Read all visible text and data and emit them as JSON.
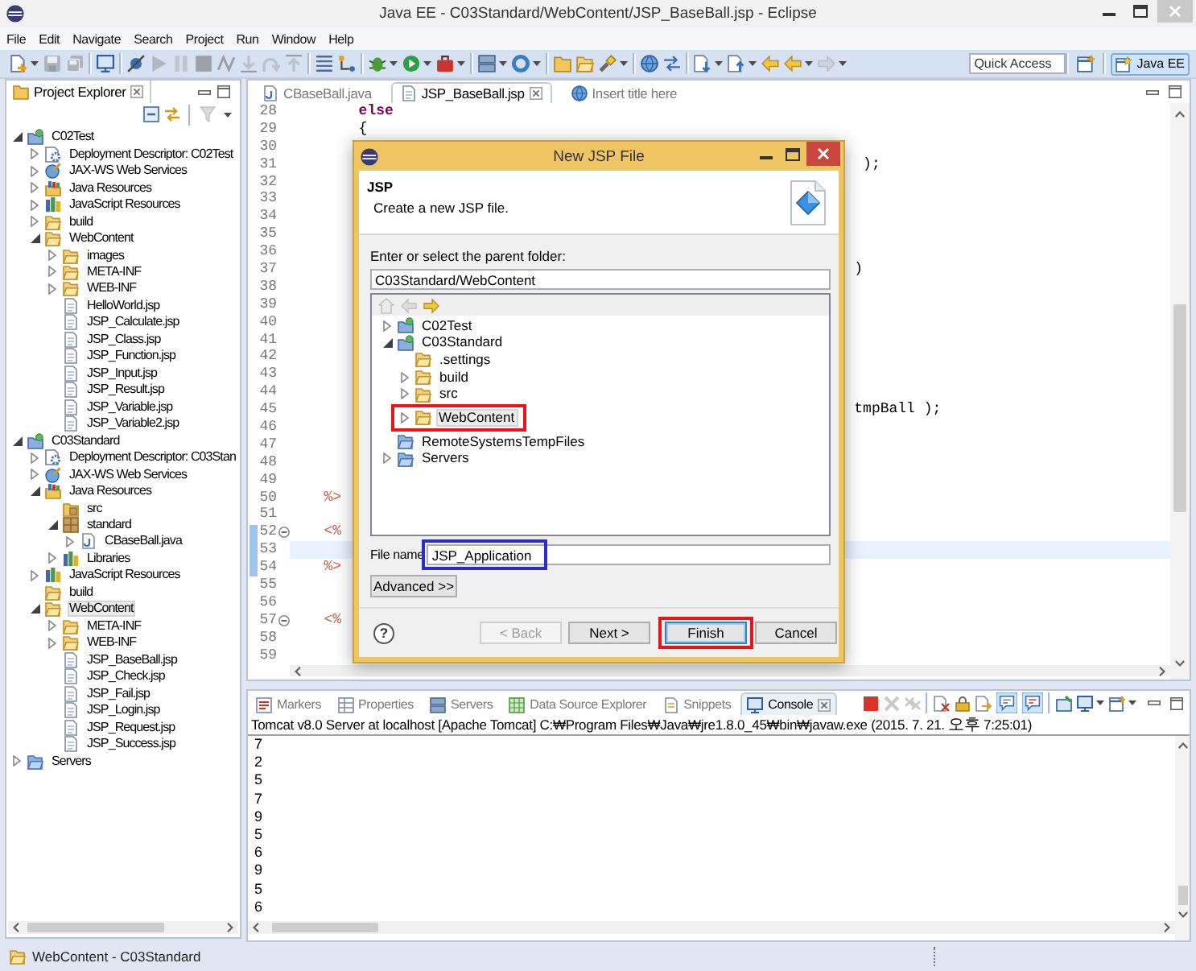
{
  "window": {
    "title": "Java EE - C03Standard/WebContent/JSP_BaseBall.jsp - Eclipse"
  },
  "menu": [
    "File",
    "Edit",
    "Navigate",
    "Search",
    "Project",
    "Run",
    "Window",
    "Help"
  ],
  "toolbar": {
    "groups": [
      [
        {
          "disabled": false,
          "dropdown": true
        },
        {
          "disabled": true,
          "dropdown": false
        },
        {
          "disabled": true,
          "dropdown": false
        }
      ],
      [
        {
          "disabled": false,
          "dropdown": false
        }
      ],
      [
        {
          "disabled": false,
          "dropdown": false
        },
        {
          "disabled": true,
          "dropdown": false
        },
        {
          "disabled": true,
          "dropdown": false
        },
        {
          "disabled": true,
          "dropdown": false
        },
        {
          "disabled": true,
          "dropdown": false
        },
        {
          "disabled": true,
          "dropdown": false
        },
        {
          "disabled": true,
          "dropdown": false
        },
        {
          "disabled": true,
          "dropdown": false
        }
      ],
      [
        {
          "disabled": false,
          "dropdown": false
        },
        {
          "disabled": false,
          "dropdown": false
        }
      ],
      [
        {
          "disabled": false,
          "dropdown": true
        },
        {
          "disabled": false,
          "dropdown": true
        },
        {
          "disabled": false,
          "dropdown": true
        }
      ],
      [
        {
          "disabled": false,
          "dropdown": true
        },
        {
          "disabled": false,
          "dropdown": true
        }
      ],
      [
        {
          "disabled": false,
          "dropdown": false
        },
        {
          "disabled": false,
          "dropdown": false
        },
        {
          "disabled": false,
          "dropdown": true
        }
      ],
      [
        {
          "disabled": false,
          "dropdown": false
        },
        {
          "disabled": false,
          "dropdown": false
        }
      ],
      [
        {
          "disabled": false,
          "dropdown": true
        },
        {
          "disabled": false,
          "dropdown": true
        },
        {
          "disabled": false,
          "dropdown": false
        },
        {
          "disabled": false,
          "dropdown": true
        },
        {
          "disabled": true,
          "dropdown": true
        }
      ]
    ],
    "quick_access": {
      "placeholder": "Quick Access"
    },
    "perspectives": [
      {
        "label": "Java EE",
        "selected": true
      }
    ]
  },
  "explorer": {
    "tab": {
      "label": "Project Explorer",
      "selected": true
    },
    "toolbar": [
      {
        "disabled": false
      },
      {
        "disabled": false
      },
      {
        "disabled": true
      }
    ],
    "tree": [
      {
        "label": "C02Test",
        "kind": "project",
        "expanded": true,
        "selected": false,
        "children": [
          {
            "label": "Deployment Descriptor: C02Test",
            "kind": "descriptor",
            "expanded": false,
            "selected": false
          },
          {
            "label": "JAX-WS Web Services",
            "kind": "webservices",
            "expanded": false,
            "selected": false
          },
          {
            "label": "Java Resources",
            "kind": "javaresources",
            "expanded": false,
            "selected": false
          },
          {
            "label": "JavaScript Resources",
            "kind": "jsresources",
            "expanded": false,
            "selected": false
          },
          {
            "label": "build",
            "kind": "folder",
            "expanded": false,
            "selected": false
          },
          {
            "label": "WebContent",
            "kind": "folder",
            "expanded": true,
            "selected": false,
            "children": [
              {
                "label": "images",
                "kind": "folder",
                "expanded": false,
                "selected": false
              },
              {
                "label": "META-INF",
                "kind": "folder",
                "expanded": false,
                "selected": false
              },
              {
                "label": "WEB-INF",
                "kind": "folder",
                "expanded": false,
                "selected": false
              },
              {
                "label": "HelloWorld.jsp",
                "kind": "jsp",
                "selected": false
              },
              {
                "label": "JSP_Calculate.jsp",
                "kind": "jsp",
                "selected": false
              },
              {
                "label": "JSP_Class.jsp",
                "kind": "jsp",
                "selected": false
              },
              {
                "label": "JSP_Function.jsp",
                "kind": "jsp",
                "selected": false
              },
              {
                "label": "JSP_Input.jsp",
                "kind": "jsp",
                "selected": false
              },
              {
                "label": "JSP_Result.jsp",
                "kind": "jsp",
                "selected": false
              },
              {
                "label": "JSP_Variable.jsp",
                "kind": "jsp",
                "selected": false
              },
              {
                "label": "JSP_Variable2.jsp",
                "kind": "jsp",
                "selected": false
              }
            ]
          }
        ]
      },
      {
        "label": "C03Standard",
        "kind": "project",
        "expanded": true,
        "selected": false,
        "children": [
          {
            "label": "Deployment Descriptor: C03Stan",
            "kind": "descriptor",
            "expanded": false,
            "selected": false
          },
          {
            "label": "JAX-WS Web Services",
            "kind": "webservices",
            "expanded": false,
            "selected": false
          },
          {
            "label": "Java Resources",
            "kind": "javaresources",
            "expanded": true,
            "selected": false,
            "children": [
              {
                "label": "src",
                "kind": "sourcefolder",
                "selected": false
              },
              {
                "label": "standard",
                "kind": "package",
                "expanded": true,
                "selected": false,
                "children": [
                  {
                    "label": "CBaseBall.java",
                    "kind": "java",
                    "expanded": false,
                    "selected": false
                  }
                ]
              },
              {
                "label": "Libraries",
                "kind": "library",
                "expanded": false,
                "selected": false
              }
            ]
          },
          {
            "label": "JavaScript Resources",
            "kind": "jsresources",
            "expanded": false,
            "selected": false
          },
          {
            "label": "build",
            "kind": "folder",
            "selected": false
          },
          {
            "label": "WebContent",
            "kind": "folder",
            "expanded": true,
            "selected": true,
            "children": [
              {
                "label": "META-INF",
                "kind": "folder",
                "expanded": false,
                "selected": false
              },
              {
                "label": "WEB-INF",
                "kind": "folder",
                "expanded": false,
                "selected": false
              },
              {
                "label": "JSP_BaseBall.jsp",
                "kind": "jsp",
                "selected": false
              },
              {
                "label": "JSP_Check.jsp",
                "kind": "jsp",
                "selected": false
              },
              {
                "label": "JSP_Fail.jsp",
                "kind": "jsp",
                "selected": false
              },
              {
                "label": "JSP_Login.jsp",
                "kind": "jsp",
                "selected": false
              },
              {
                "label": "JSP_Request.jsp",
                "kind": "jsp",
                "selected": false
              },
              {
                "label": "JSP_Success.jsp",
                "kind": "jsp",
                "selected": false
              }
            ]
          }
        ]
      },
      {
        "label": "Servers",
        "kind": "serverfolder",
        "expanded": false,
        "selected": false
      }
    ]
  },
  "editor": {
    "tabs": [
      {
        "label": "CBaseBall.java",
        "kind": "java",
        "selected": false
      },
      {
        "label": "JSP_BaseBall.jsp",
        "kind": "jsp",
        "selected": true
      },
      {
        "label": "Insert title here",
        "kind": "web",
        "selected": false
      }
    ],
    "lines": [
      {
        "number": "28",
        "code": "       else",
        "kind": "keyword",
        "current": false,
        "range": false
      },
      {
        "number": "29",
        "code": "       {",
        "kind": "plain",
        "current": false,
        "range": false
      },
      {
        "number": "30",
        "current": false,
        "range": false
      },
      {
        "number": "31",
        "code": "                                                                 );",
        "kind": "plain",
        "current": false,
        "range": false
      },
      {
        "number": "32",
        "current": false,
        "range": false
      },
      {
        "number": "33",
        "current": false,
        "range": false
      },
      {
        "number": "34",
        "current": false,
        "range": false
      },
      {
        "number": "35",
        "current": false,
        "range": false
      },
      {
        "number": "36",
        "current": false,
        "range": false
      },
      {
        "number": "37",
        "code": "                                                                )",
        "kind": "plain",
        "current": false,
        "range": false
      },
      {
        "number": "38",
        "current": false,
        "range": false
      },
      {
        "number": "39",
        "current": false,
        "range": false
      },
      {
        "number": "40",
        "current": false,
        "range": false
      },
      {
        "number": "41",
        "current": false,
        "range": false
      },
      {
        "number": "42",
        "current": false,
        "range": false
      },
      {
        "number": "43",
        "current": false,
        "range": false
      },
      {
        "number": "44",
        "current": false,
        "range": false
      },
      {
        "number": "45",
        "code": "                                                                tmpBall );",
        "kind": "plain",
        "current": false,
        "range": false
      },
      {
        "number": "46",
        "current": false,
        "range": false
      },
      {
        "number": "47",
        "current": false,
        "range": false
      },
      {
        "number": "48",
        "current": false,
        "range": false
      },
      {
        "number": "49",
        "current": false,
        "range": false
      },
      {
        "number": "50",
        "code": "   %>",
        "kind": "delimiter",
        "current": false,
        "range": false
      },
      {
        "number": "51",
        "current": false,
        "range": false
      },
      {
        "number": "52",
        "code": "   <%",
        "kind": "delimiter",
        "expanded": true,
        "current": false,
        "range": true
      },
      {
        "number": "53",
        "current": true,
        "range": true
      },
      {
        "number": "54",
        "code": "   %>",
        "kind": "delimiter",
        "current": false,
        "range": true
      },
      {
        "number": "55",
        "current": false,
        "range": false
      },
      {
        "number": "56",
        "current": false,
        "range": false
      },
      {
        "number": "57",
        "code": "   <%",
        "kind": "delimiter",
        "expanded": true,
        "current": false,
        "range": false
      },
      {
        "number": "58",
        "current": false,
        "range": false
      },
      {
        "number": "59",
        "current": false,
        "range": false
      }
    ]
  },
  "dialog": {
    "title": "New JSP File",
    "heading": "JSP",
    "description": "Create a new JSP file.",
    "folder_label": "Enter or select the parent folder:",
    "folder_value": "C03Standard/WebContent",
    "tree_toolbar": [
      {
        "disabled": true
      },
      {
        "disabled": true
      },
      {
        "disabled": false
      }
    ],
    "tree": [
      {
        "label": "C02Test",
        "kind": "project",
        "expanded": false,
        "selected": false
      },
      {
        "label": "C03Standard",
        "kind": "project",
        "expanded": true,
        "selected": false,
        "children": [
          {
            "label": ".settings",
            "kind": "folder",
            "selected": false
          },
          {
            "label": "build",
            "kind": "folder",
            "expanded": false,
            "selected": false
          },
          {
            "label": "src",
            "kind": "folder",
            "expanded": false,
            "selected": false
          },
          {
            "label": "WebContent",
            "kind": "folder",
            "expanded": false,
            "selected": true,
            "highlight": {
              "color": "#e8151b"
            }
          }
        ]
      },
      {
        "label": "RemoteSystemsTempFiles",
        "kind": "serverfolder",
        "selected": false
      },
      {
        "label": "Servers",
        "kind": "serverfolder",
        "expanded": false,
        "selected": false
      }
    ],
    "file_name": {
      "label": "File name",
      "value": "JSP_Application",
      "highlight": {
        "color": "#2b2bd0"
      }
    },
    "advanced": "Advanced >>",
    "help": "?",
    "buttons": [
      {
        "label": "< Back",
        "disabled": true,
        "default": false
      },
      {
        "label": "Next >",
        "disabled": false,
        "default": false
      },
      {
        "label": "Finish",
        "disabled": false,
        "default": true,
        "highlight": {
          "color": "#e8151b"
        }
      },
      {
        "label": "Cancel",
        "disabled": false,
        "default": false
      }
    ]
  },
  "console": {
    "tabs": [
      {
        "label": "Markers",
        "selected": false
      },
      {
        "label": "Properties",
        "selected": false
      },
      {
        "label": "Servers",
        "selected": false
      },
      {
        "label": "Data Source Explorer",
        "selected": false
      },
      {
        "label": "Snippets",
        "selected": false
      },
      {
        "label": "Console",
        "selected": true
      }
    ],
    "toolbar": {
      "groups": [
        [
          {
            "disabled": false,
            "on": false,
            "dropdown": false
          },
          {
            "disabled": true,
            "on": false,
            "dropdown": false
          },
          {
            "disabled": true,
            "on": false,
            "dropdown": false
          }
        ],
        [
          {
            "disabled": false,
            "on": false,
            "dropdown": false
          },
          {
            "disabled": false,
            "on": false,
            "dropdown": false
          },
          {
            "disabled": false,
            "on": false,
            "dropdown": false
          },
          {
            "disabled": false,
            "on": true,
            "dropdown": false
          },
          {
            "disabled": false,
            "on": true,
            "dropdown": false
          }
        ],
        [
          {
            "disabled": false,
            "on": false,
            "dropdown": false
          },
          {
            "disabled": false,
            "on": false,
            "dropdown": true
          },
          {
            "disabled": false,
            "on": false,
            "dropdown": true
          }
        ]
      ]
    },
    "process": "Tomcat v8.0 Server at localhost [Apache Tomcat] C:₩Program Files₩Java₩jre1.8.0_45₩bin₩javaw.exe (2015. 7. 21. 오후 7:25:01)",
    "output": [
      "7",
      "2",
      "5",
      "7",
      "9",
      "5",
      "6",
      "9",
      "5",
      "6"
    ]
  },
  "status_bar": {
    "text": "WebContent - C03Standard"
  }
}
